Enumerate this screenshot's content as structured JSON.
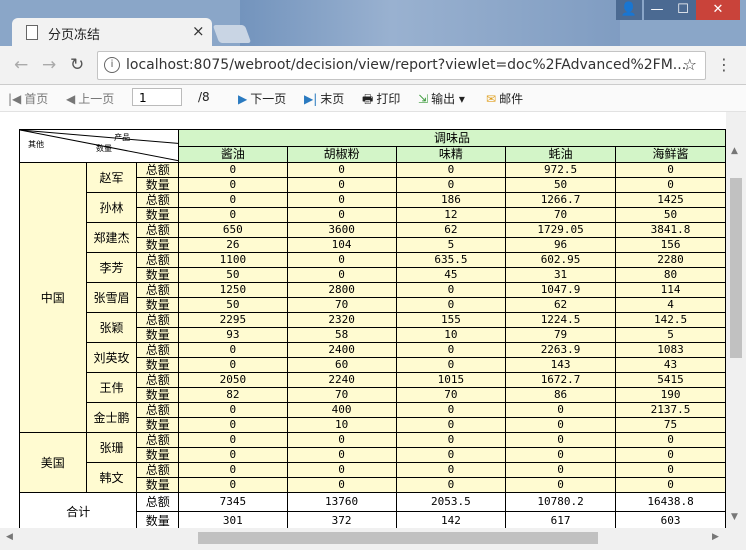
{
  "browser": {
    "tab_title": "分页冻结",
    "url": "localhost:8075/webroot/decision/view/report?viewlet=doc%2FAdvanced%2FM...",
    "info_icon": "i",
    "window_buttons": [
      "👤",
      "—",
      "☐",
      "✕"
    ]
  },
  "toolbar": {
    "first": "首页",
    "prev": "上一页",
    "page_value": "1",
    "page_total": "/8",
    "next": "下一页",
    "last": "末页",
    "print": "打印",
    "export": "输出",
    "mail": "邮件"
  },
  "report": {
    "corner": {
      "product": "产品",
      "qty": "数量",
      "other": "其他"
    },
    "group_header": "调味品",
    "products": [
      "酱油",
      "胡椒粉",
      "味精",
      "蚝油",
      "海鲜酱"
    ],
    "metric_labels": {
      "amount": "总额",
      "qty": "数量"
    },
    "regions": [
      {
        "name": "中国",
        "people": [
          {
            "name": "赵军",
            "amount": [
              "0",
              "0",
              "0",
              "972.5",
              "0"
            ],
            "qty": [
              "0",
              "0",
              "0",
              "50",
              "0"
            ]
          },
          {
            "name": "孙林",
            "amount": [
              "0",
              "0",
              "186",
              "1266.7",
              "1425"
            ],
            "qty": [
              "0",
              "0",
              "12",
              "70",
              "50"
            ]
          },
          {
            "name": "郑建杰",
            "amount": [
              "650",
              "3600",
              "62",
              "1729.05",
              "3841.8"
            ],
            "qty": [
              "26",
              "104",
              "5",
              "96",
              "156"
            ]
          },
          {
            "name": "李芳",
            "amount": [
              "1100",
              "0",
              "635.5",
              "602.95",
              "2280"
            ],
            "qty": [
              "50",
              "0",
              "45",
              "31",
              "80"
            ]
          },
          {
            "name": "张雪眉",
            "amount": [
              "1250",
              "2800",
              "0",
              "1047.9",
              "114"
            ],
            "qty": [
              "50",
              "70",
              "0",
              "62",
              "4"
            ]
          },
          {
            "name": "张颖",
            "amount": [
              "2295",
              "2320",
              "155",
              "1224.5",
              "142.5"
            ],
            "qty": [
              "93",
              "58",
              "10",
              "79",
              "5"
            ]
          },
          {
            "name": "刘英玫",
            "amount": [
              "0",
              "2400",
              "0",
              "2263.9",
              "1083"
            ],
            "qty": [
              "0",
              "60",
              "0",
              "143",
              "43"
            ]
          },
          {
            "name": "王伟",
            "amount": [
              "2050",
              "2240",
              "1015",
              "1672.7",
              "5415"
            ],
            "qty": [
              "82",
              "70",
              "70",
              "86",
              "190"
            ]
          },
          {
            "name": "金士鹏",
            "amount": [
              "0",
              "400",
              "0",
              "0",
              "2137.5"
            ],
            "qty": [
              "0",
              "10",
              "0",
              "0",
              "75"
            ]
          }
        ]
      },
      {
        "name": "美国",
        "people": [
          {
            "name": "张珊",
            "amount": [
              "0",
              "0",
              "0",
              "0",
              "0"
            ],
            "qty": [
              "0",
              "0",
              "0",
              "0",
              "0"
            ]
          },
          {
            "name": "韩文",
            "amount": [
              "0",
              "0",
              "0",
              "0",
              "0"
            ],
            "qty": [
              "0",
              "0",
              "0",
              "0",
              "0"
            ]
          }
        ]
      }
    ],
    "total": {
      "label": "合计",
      "amount": [
        "7345",
        "13760",
        "2053.5",
        "10780.2",
        "16438.8"
      ],
      "qty": [
        "301",
        "372",
        "142",
        "617",
        "603"
      ]
    }
  }
}
